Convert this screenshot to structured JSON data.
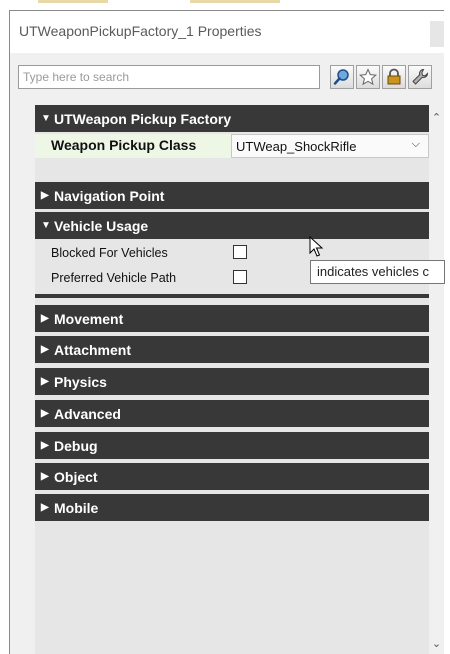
{
  "window": {
    "title": "UTWeaponPickupFactory_1 Properties"
  },
  "search": {
    "placeholder": "Type here to search",
    "value": ""
  },
  "toolbar": {
    "buttons": [
      "search-icon",
      "star-icon",
      "lock-icon",
      "wrench-icon"
    ]
  },
  "sections": {
    "pickup": {
      "label": "UTWeapon Pickup Factory",
      "expanded": true
    },
    "navigation": {
      "label": "Navigation Point",
      "expanded": false
    },
    "vehicle": {
      "label": "Vehicle Usage",
      "expanded": true
    },
    "movement": {
      "label": "Movement",
      "expanded": false
    },
    "attachment": {
      "label": "Attachment",
      "expanded": false
    },
    "physics": {
      "label": "Physics",
      "expanded": false
    },
    "advanced": {
      "label": "Advanced",
      "expanded": false
    },
    "debug": {
      "label": "Debug",
      "expanded": false
    },
    "object": {
      "label": "Object",
      "expanded": false
    },
    "mobile": {
      "label": "Mobile",
      "expanded": false
    }
  },
  "properties": {
    "weapon_pickup_class": {
      "label": "Weapon Pickup Class",
      "value": "UTWeap_ShockRifle"
    },
    "blocked_for_vehicles": {
      "label": "Blocked For Vehicles",
      "checked": false
    },
    "preferred_vehicle_path": {
      "label": "Preferred Vehicle Path",
      "checked": false
    }
  },
  "tooltip": {
    "text": "indicates vehicles c"
  },
  "colors": {
    "section_header": "#383838",
    "panel_bg": "#e6e6e6",
    "highlight_row": "#eef7e6"
  }
}
